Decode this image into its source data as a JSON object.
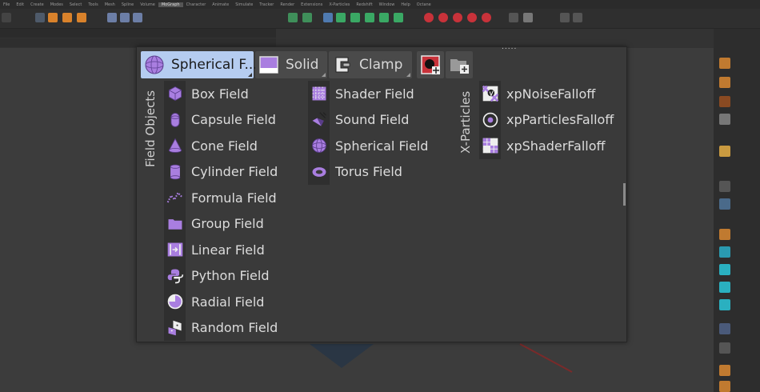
{
  "menubar": {
    "items": [
      "File",
      "Edit",
      "Create",
      "Modes",
      "Select",
      "Tools",
      "Mesh",
      "Spline",
      "Volume",
      "MoGraph",
      "Character",
      "Animate",
      "Simulate",
      "Tracker",
      "Render",
      "Extensions",
      "X-Particles",
      "Redshift",
      "Window",
      "Help",
      "Octane"
    ],
    "active_index": 9
  },
  "popup": {
    "tabs": [
      {
        "label": "Spherical F..."
      },
      {
        "label": "Solid"
      },
      {
        "label": "Clamp"
      }
    ],
    "dots": "....."
  },
  "groups": {
    "field_objects_label": "Field Objects",
    "xparticles_label": "X-Particles"
  },
  "field_objects_col1": [
    {
      "label": "Box Field",
      "icon": "box-icon"
    },
    {
      "label": "Capsule Field",
      "icon": "capsule-icon"
    },
    {
      "label": "Cone Field",
      "icon": "cone-icon"
    },
    {
      "label": "Cylinder Field",
      "icon": "cylinder-icon"
    },
    {
      "label": "Formula Field",
      "icon": "formula-icon"
    },
    {
      "label": "Group Field",
      "icon": "folder-icon"
    },
    {
      "label": "Linear Field",
      "icon": "linear-icon"
    },
    {
      "label": "Python Field",
      "icon": "python-icon"
    },
    {
      "label": "Radial Field",
      "icon": "radial-icon"
    },
    {
      "label": "Random Field",
      "icon": "dice-icon"
    }
  ],
  "field_objects_col2": [
    {
      "label": "Shader Field",
      "icon": "shader-icon"
    },
    {
      "label": "Sound Field",
      "icon": "speaker-icon"
    },
    {
      "label": "Spherical Field",
      "icon": "sphere-icon"
    },
    {
      "label": "Torus Field",
      "icon": "torus-icon"
    }
  ],
  "xparticles": [
    {
      "label": "xpNoiseFalloff",
      "icon": "noise-falloff-icon"
    },
    {
      "label": "xpParticlesFalloff",
      "icon": "particles-falloff-icon"
    },
    {
      "label": "xpShaderFalloff",
      "icon": "shader-falloff-icon"
    }
  ],
  "colors": {
    "accent": "#b5ccf0",
    "icon_purple": "#a97ee0",
    "background": "#333333"
  }
}
